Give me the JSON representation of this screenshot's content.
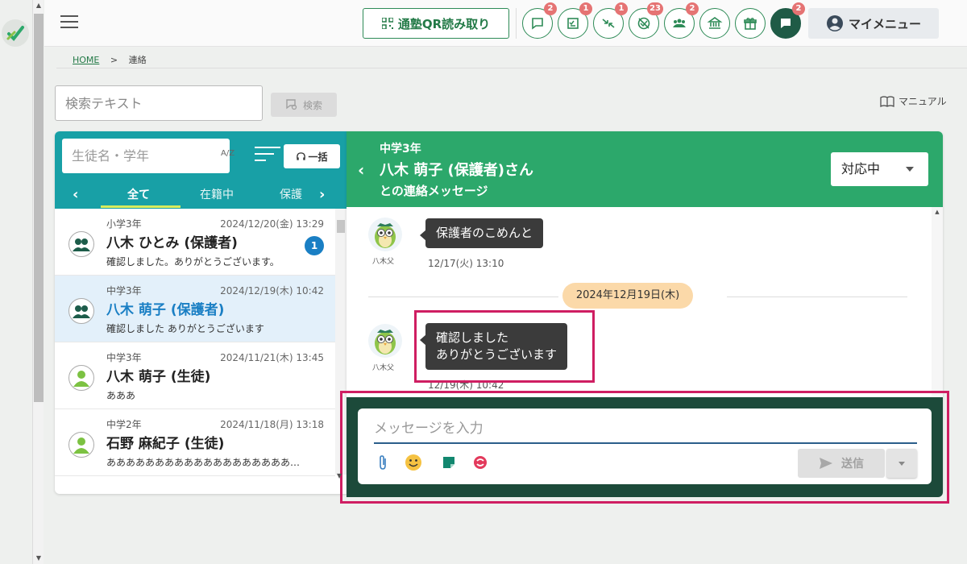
{
  "header": {
    "qr_label": "通塾QR読み取り",
    "icons": [
      {
        "name": "chat-bubble-icon",
        "badge": "2"
      },
      {
        "name": "checklist-icon",
        "badge": "1"
      },
      {
        "name": "merge-arrows-icon",
        "badge": "1"
      },
      {
        "name": "no-attendance-icon",
        "badge": "23"
      },
      {
        "name": "group-icon",
        "badge": "2"
      },
      {
        "name": "bank-icon",
        "badge": ""
      },
      {
        "name": "gift-icon",
        "badge": ""
      },
      {
        "name": "message-icon",
        "badge": "2"
      }
    ],
    "mymenu_label": "マイメニュー"
  },
  "breadcrumb": {
    "home": "HOME",
    "separator": ">",
    "current": "連絡"
  },
  "search": {
    "placeholder": "検索テキスト",
    "button_label": "検索"
  },
  "manual_label": "マニュアル",
  "student_search": {
    "placeholder": "生徒名・学年",
    "az_label": "A/Z",
    "bulk_label": "一括"
  },
  "tabs": [
    {
      "label": "全て",
      "active": true
    },
    {
      "label": "在籍中",
      "active": false
    },
    {
      "label": "保護",
      "active": false
    }
  ],
  "contacts": [
    {
      "grade": "小学3年",
      "date": "2024/12/20(金) 13:29",
      "name": "八木 ひとみ (保護者)",
      "preview": "確認しました。ありがとうございます。",
      "unread": "1",
      "type": "guardian",
      "selected": false
    },
    {
      "grade": "中学3年",
      "date": "2024/12/19(木) 10:42",
      "name": "八木 萌子 (保護者)",
      "preview": "確認しました ありがとうございます",
      "unread": "",
      "type": "guardian",
      "selected": true
    },
    {
      "grade": "中学3年",
      "date": "2024/11/21(木) 13:45",
      "name": "八木 萌子 (生徒)",
      "preview": "あああ",
      "unread": "",
      "type": "student",
      "selected": false
    },
    {
      "grade": "中学2年",
      "date": "2024/11/18(月) 13:18",
      "name": "石野 麻紀子 (生徒)",
      "preview": "あああああああああああああああああああ…",
      "unread": "",
      "type": "student",
      "selected": false
    }
  ],
  "conversation": {
    "grade": "中学3年",
    "name": "八木 萌子 (保護者)さん",
    "subtitle": "との連絡メッセージ",
    "status": "対応中"
  },
  "messages": [
    {
      "sender": "八木父",
      "text": "保護者のこめんと",
      "time": "12/17(火) 13:10"
    },
    {
      "sender": "八木父",
      "text": "確認しました\nありがとうございます",
      "time": "12/19(木) 10:42"
    }
  ],
  "day_divider": "2024年12月19日(木)",
  "composer": {
    "placeholder": "メッセージを入力",
    "send_label": "送信"
  },
  "colors": {
    "teal": "#18a0a6",
    "green": "#2ca86b",
    "dark_green": "#1c4a3a",
    "highlight": "#cf1e62",
    "badge": "#e57373",
    "selected_name": "#1a7fc4"
  }
}
